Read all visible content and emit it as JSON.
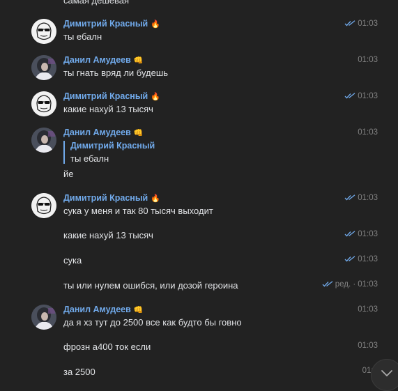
{
  "messages": [
    {
      "text": "самая дешевая"
    },
    {
      "author": "Димитрий Красный",
      "author_emoji": "🔥",
      "text": "ты ебалн",
      "time": "01:03",
      "read": true
    },
    {
      "author": "Данил Амудеев",
      "author_emoji": "👊",
      "text": "ты гнать вряд ли будешь",
      "time": "01:03"
    },
    {
      "author": "Димитрий Красный",
      "author_emoji": "🔥",
      "text": "какие нахуй 13 тысяч",
      "time": "01:03",
      "read": true
    },
    {
      "author": "Данил Амудеев",
      "author_emoji": "👊",
      "reply_author": "Димитрий Красный",
      "reply_text": "ты ебалн",
      "text": "йе",
      "time": "01:03"
    },
    {
      "author": "Димитрий Красный",
      "author_emoji": "🔥",
      "text": "сука у меня и так 80 тысяч выходит",
      "time": "01:03",
      "read": true
    },
    {
      "text": "какие нахуй 13 тысяч",
      "time": "01:03",
      "read": true
    },
    {
      "text": "сука",
      "time": "01:03",
      "read": true
    },
    {
      "text": "ты или нулем ошибся, или дозой героина",
      "time": "01:03",
      "read": true,
      "edited": "ред. ·"
    },
    {
      "author": "Данил Амудеев",
      "author_emoji": "👊",
      "text": "да я хз тут до 2500 все как будто бы говно",
      "time": "01:03"
    },
    {
      "text": "фрозн а400 ток если",
      "time": "01:03"
    },
    {
      "text": "за 2500",
      "time": "01:0"
    }
  ],
  "icons": {
    "read_checks": "double-check-icon",
    "scroll_down": "chevron-down-icon",
    "avatar_dmitry": "sunglasses-face-avatar",
    "avatar_danil": "photo-avatar"
  },
  "colors": {
    "background": "#222222",
    "author": "#71aaeb",
    "text": "#e1e3e6",
    "time": "#828282"
  }
}
